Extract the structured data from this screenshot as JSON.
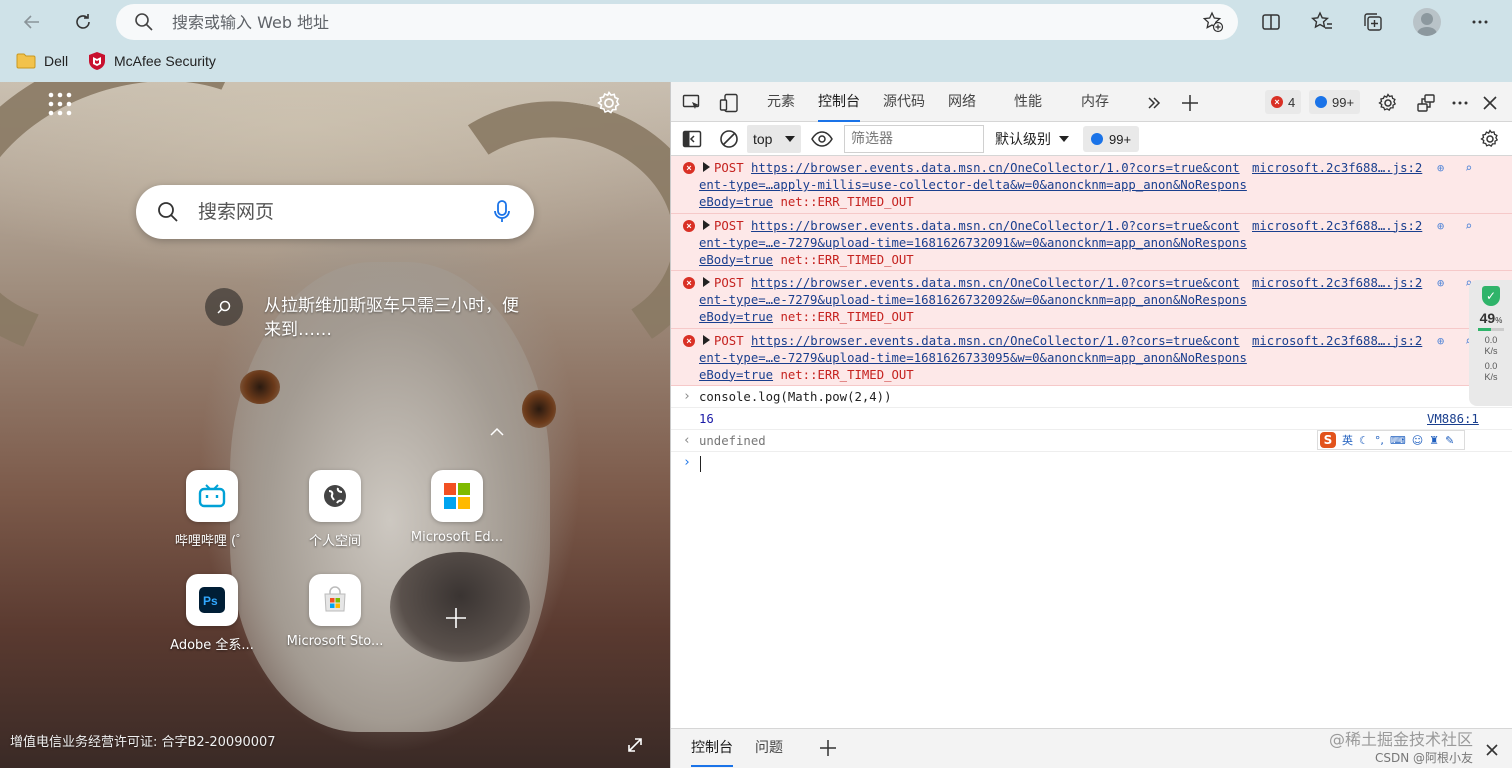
{
  "address_bar": {
    "placeholder": "搜索或输入 Web 地址"
  },
  "favorites": [
    {
      "label": "Dell",
      "icon": "folder-icon"
    },
    {
      "label": "McAfee Security",
      "icon": "mcafee-logo-icon"
    }
  ],
  "new_tab": {
    "search_placeholder": "搜索网页",
    "caption": "从拉斯维加斯驱车只需三小时，便来到……",
    "tiles": [
      {
        "label": "哔哩哔哩 (゜",
        "icon": "bilibili-icon"
      },
      {
        "label": "个人空间",
        "icon": "globe-icon"
      },
      {
        "label": "Microsoft Ed...",
        "icon": "microsoft-logo-icon"
      },
      {
        "label": "Adobe 全系...",
        "icon": "photoshop-icon"
      },
      {
        "label": "Microsoft Sto...",
        "icon": "store-icon"
      }
    ],
    "license": "增值电信业务经营许可证: 合字B2-20090007"
  },
  "devtools": {
    "tabs": [
      "元素",
      "控制台",
      "源代码",
      "网络",
      "性能",
      "内存"
    ],
    "active_tab": "控制台",
    "error_count": "4",
    "message_count": "99+",
    "context": "top",
    "filter_placeholder": "筛选器",
    "level": "默认级别",
    "console": {
      "errors": [
        {
          "method": "POST",
          "url": "https://browser.events.data.msn.cn/OneCollector/1.0?cors=true&content-type=…apply-millis=use-collector-delta&w=0&anoncknm=app_anon&NoResponseBody=true",
          "error": "net::ERR_TIMED_OUT",
          "source": "microsoft.2c3f688….js:2"
        },
        {
          "method": "POST",
          "url": "https://browser.events.data.msn.cn/OneCollector/1.0?cors=true&content-type=…e-7279&upload-time=1681626732091&w=0&anoncknm=app_anon&NoResponseBody=true",
          "error": "net::ERR_TIMED_OUT",
          "source": "microsoft.2c3f688….js:2"
        },
        {
          "method": "POST",
          "url": "https://browser.events.data.msn.cn/OneCollector/1.0?cors=true&content-type=…e-7279&upload-time=1681626732092&w=0&anoncknm=app_anon&NoResponseBody=true",
          "error": "net::ERR_TIMED_OUT",
          "source": "microsoft.2c3f688….js:2"
        },
        {
          "method": "POST",
          "url": "https://browser.events.data.msn.cn/OneCollector/1.0?cors=true&content-type=…e-7279&upload-time=1681626733095&w=0&anoncknm=app_anon&NoResponseBody=true",
          "error": "net::ERR_TIMED_OUT",
          "source": "microsoft.2c3f688….js:2"
        }
      ],
      "input": "console.log(Math.pow(2,4))",
      "output": "16",
      "output_source": "VM886:1",
      "return_value": "undefined"
    },
    "ime_label": "英",
    "net_meter": {
      "percent": "49",
      "percent_unit": "%",
      "up": "0.0",
      "down": "0.0",
      "unit": "K/s"
    },
    "drawer_tabs": [
      "控制台",
      "问题"
    ],
    "watermark_1": "@稀土掘金技术社区",
    "watermark_2": "CSDN @阿根小友"
  }
}
